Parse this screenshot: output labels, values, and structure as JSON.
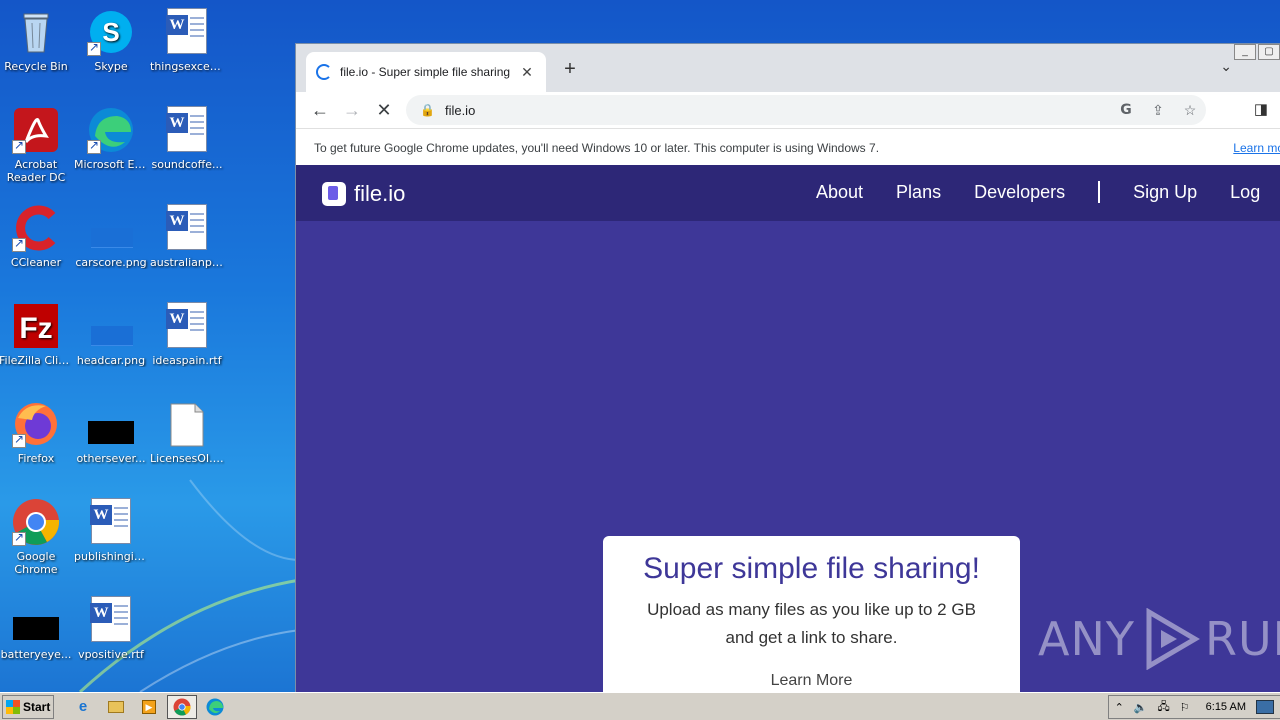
{
  "desktop": {
    "icons": [
      {
        "label": "Recycle Bin",
        "icon": "recycle-bin-icon"
      },
      {
        "label": "Skype",
        "icon": "skype-icon"
      },
      {
        "label": "thingsexcep...",
        "icon": "word-document-icon"
      },
      {
        "label": "Acrobat Reader DC",
        "icon": "acrobat-icon"
      },
      {
        "label": "Microsoft Edge",
        "icon": "edge-icon"
      },
      {
        "label": "soundcoffe...",
        "icon": "word-document-icon"
      },
      {
        "label": "CCleaner",
        "icon": "ccleaner-icon"
      },
      {
        "label": "carscore.png",
        "icon": "image-file-icon"
      },
      {
        "label": "australianpr...",
        "icon": "word-document-icon"
      },
      {
        "label": "FileZilla Client",
        "icon": "filezilla-icon"
      },
      {
        "label": "headcar.png",
        "icon": "image-file-icon"
      },
      {
        "label": "ideaspain.rtf",
        "icon": "word-document-icon"
      },
      {
        "label": "Firefox",
        "icon": "firefox-icon"
      },
      {
        "label": "othersever...",
        "icon": "black-thumbnail-icon"
      },
      {
        "label": "LicensesOI.txt",
        "icon": "text-file-icon"
      },
      {
        "label": "Google Chrome",
        "icon": "chrome-icon"
      },
      {
        "label": "publishingin...",
        "icon": "word-document-icon"
      },
      {
        "label": "batteryeye...",
        "icon": "black-thumbnail-icon"
      },
      {
        "label": "vpositive.rtf",
        "icon": "word-document-icon"
      }
    ]
  },
  "browser": {
    "tab_title": "file.io - Super simple file sharing",
    "tab_close": "✕",
    "new_tab": "+",
    "tab_menu": "⌄",
    "address": "file.io",
    "infobar_text": "To get future Google Chrome updates, you'll need Windows 10 or later. This computer is using Windows 7.",
    "infobar_link": "Learn mo"
  },
  "site": {
    "logo_text": "file.io",
    "nav": [
      "About",
      "Plans",
      "Developers",
      "Sign Up",
      "Log"
    ],
    "hero_title": "Super simple file sharing!",
    "hero_line1": "Upload as many files as you like up to 2 GB",
    "hero_line2": "and get a link to share.",
    "learn_more": "Learn More"
  },
  "watermark": {
    "left": "ANY",
    "right": "RUN"
  },
  "taskbar": {
    "start_label": "Start",
    "time": "6:15 AM"
  }
}
